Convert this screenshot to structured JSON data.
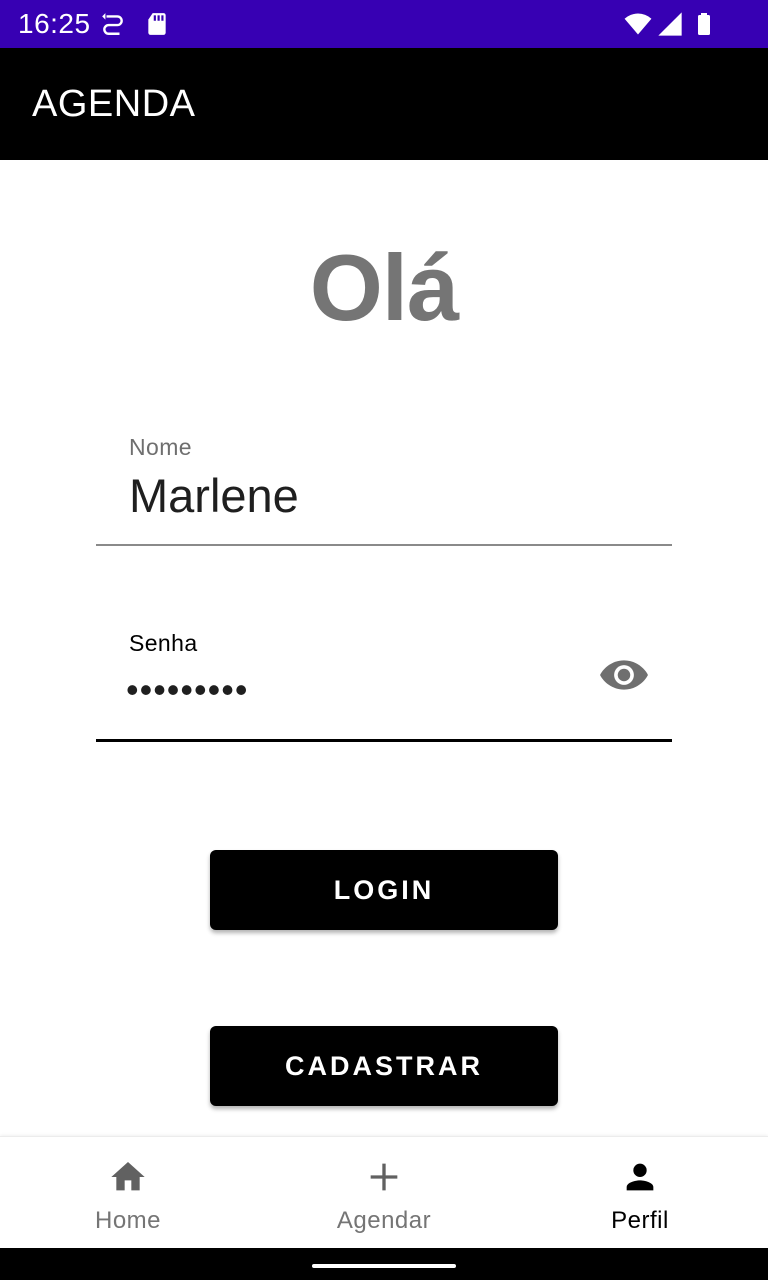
{
  "status_bar": {
    "time": "16:25",
    "background": "#3700b3",
    "left_icons": [
      "sync-icon",
      "sd-card-icon"
    ],
    "right_icons": [
      "wifi-icon",
      "cell-signal-icon",
      "battery-icon"
    ]
  },
  "app_bar": {
    "title": "AGENDA",
    "background": "#000000"
  },
  "greeting": "Olá",
  "form": {
    "nome": {
      "label": "Nome",
      "value": "Marlene"
    },
    "senha": {
      "label": "Senha",
      "masked_value": "•••••••••",
      "toggle_icon": "eye-icon"
    }
  },
  "buttons": {
    "login": "LOGIN",
    "cadastrar": "CADASTRAR"
  },
  "bottom_nav": {
    "items": [
      {
        "label": "Home",
        "icon": "home-icon",
        "active": false
      },
      {
        "label": "Agendar",
        "icon": "plus-icon",
        "active": false
      },
      {
        "label": "Perfil",
        "icon": "person-icon",
        "active": true
      }
    ]
  },
  "colors": {
    "accent": "#000000",
    "status_bar": "#3700b3",
    "inactive": "#757575"
  }
}
